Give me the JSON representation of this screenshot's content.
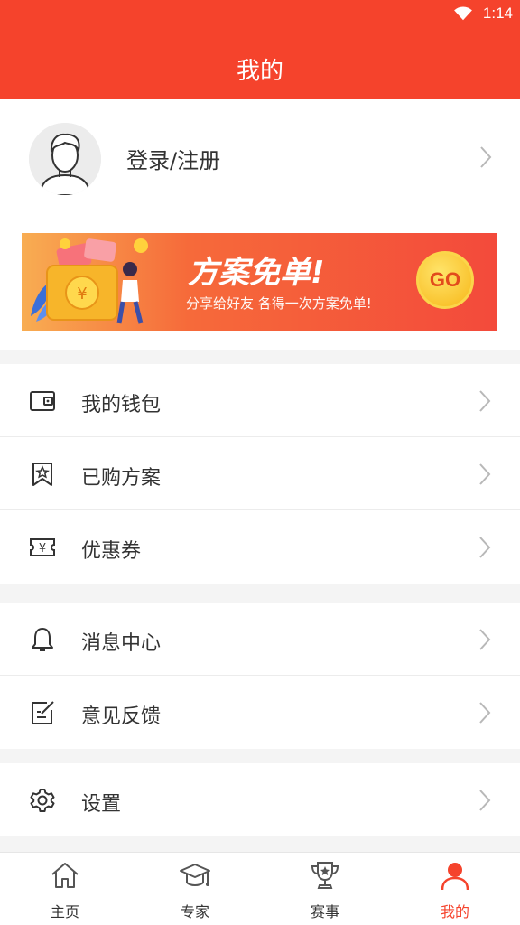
{
  "status_bar": {
    "time": "1:14"
  },
  "header": {
    "title": "我的"
  },
  "profile": {
    "login_label": "登录/注册"
  },
  "banner": {
    "title": "方案免单!",
    "subtitle": "分享给好友 各得一次方案免单!",
    "go_label": "GO"
  },
  "menu_groups": [
    [
      {
        "label": "我的钱包",
        "icon": "wallet-icon"
      },
      {
        "label": "已购方案",
        "icon": "bookmark-star-icon"
      },
      {
        "label": "优惠券",
        "icon": "coupon-icon"
      }
    ],
    [
      {
        "label": "消息中心",
        "icon": "bell-icon"
      },
      {
        "label": "意见反馈",
        "icon": "feedback-icon"
      }
    ],
    [
      {
        "label": "设置",
        "icon": "gear-icon"
      }
    ]
  ],
  "tabs": [
    {
      "label": "主页",
      "icon": "home-icon"
    },
    {
      "label": "专家",
      "icon": "graduation-cap-icon"
    },
    {
      "label": "赛事",
      "icon": "trophy-icon"
    },
    {
      "label": "我的",
      "icon": "person-icon",
      "active": true
    }
  ],
  "colors": {
    "accent": "#f5432c",
    "text": "#333333",
    "inactive": "#555555"
  }
}
